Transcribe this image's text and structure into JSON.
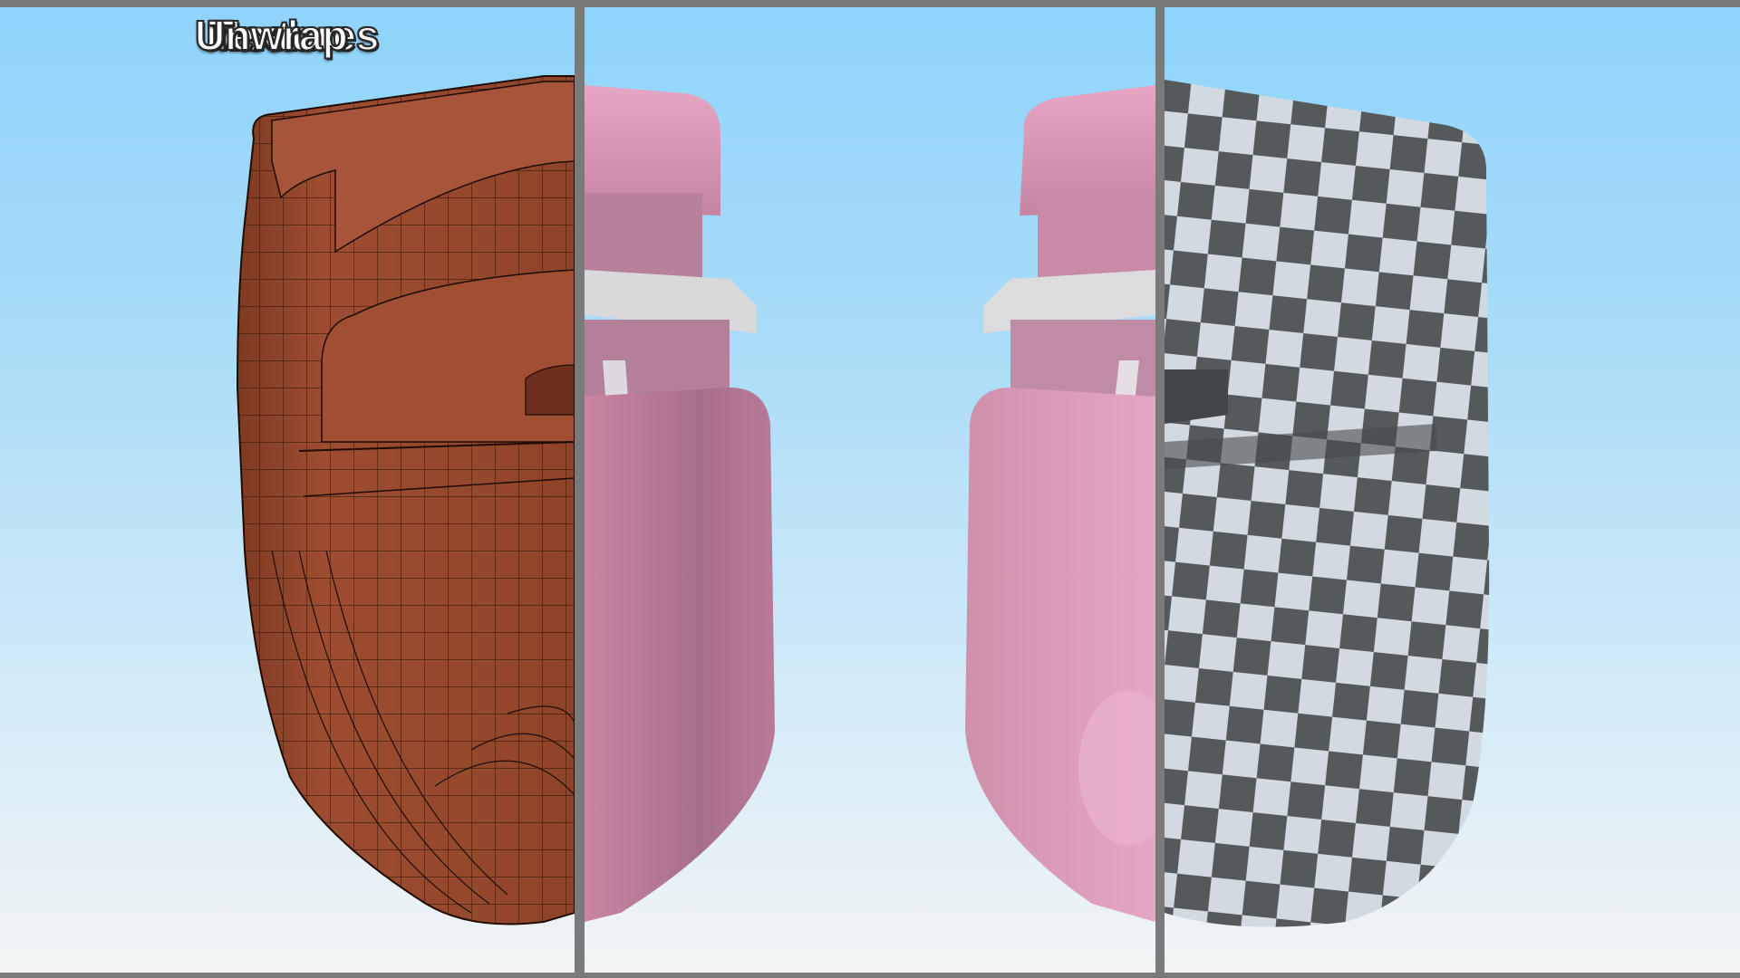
{
  "panels": {
    "mesh": {
      "label": "Mesh"
    },
    "textures": {
      "label": "Textures"
    },
    "unwrap": {
      "label": "Unwrap"
    }
  },
  "colors": {
    "frame": "#7a7a7a",
    "sky_top": "#8fd4fb",
    "sky_bottom": "#f2f4f5",
    "mesh_body": "#9a4a30",
    "mesh_wire": "#1f0c05",
    "texture_pink": "#d48fae",
    "checker_dark": "#5a5f62",
    "checker_light": "#dfe7ee"
  }
}
